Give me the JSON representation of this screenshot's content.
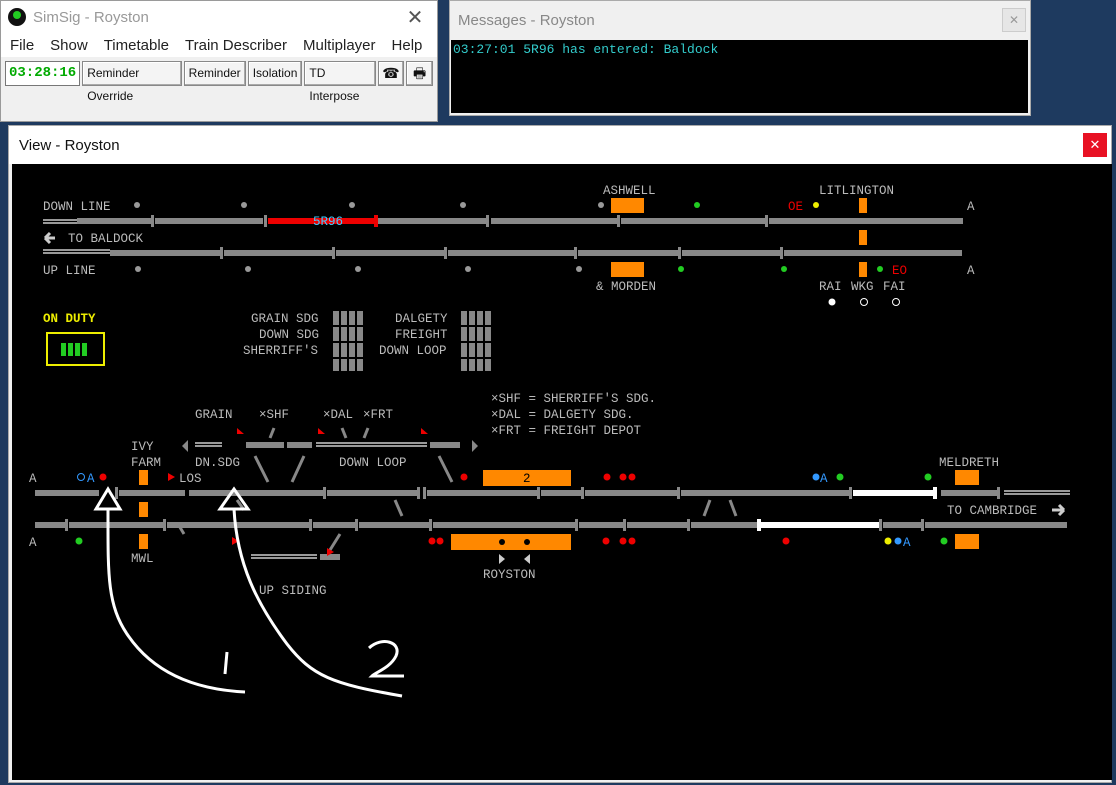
{
  "main_window": {
    "title": "SimSig - Royston",
    "close": "✕",
    "menu": [
      "File",
      "Show",
      "Timetable",
      "Train Describer",
      "Multiplayer",
      "Help"
    ],
    "clock": "03:28:16",
    "buttons": [
      "Reminder Override",
      "Reminder",
      "Isolation",
      "TD Interpose"
    ],
    "phone_icon": "☎",
    "printer_icon": "🖶"
  },
  "messages_window": {
    "title": "Messages - Royston",
    "close": "✕",
    "lines": [
      "03:27:01 5R96 has entered: Baldock"
    ]
  },
  "view_window": {
    "title": "View - Royston",
    "close": "✕"
  },
  "diagram": {
    "top": {
      "down_line": "DOWN LINE",
      "to_baldock": "TO BALDOCK",
      "up_line": "UP LINE",
      "ashwell": "ASHWELL",
      "and_morden": "& MORDEN",
      "litlington": "LITLINGTON",
      "train": "5R96",
      "oe": "OE",
      "eo": "EO",
      "rai": "RAI",
      "wkg": "WKG",
      "fai": "FAI",
      "a1": "A",
      "a2": "A"
    },
    "on_duty": "ON DUTY",
    "indicators": {
      "grain_sdg": "GRAIN SDG",
      "down_sdg": "DOWN SDG",
      "sherriffs": "SHERRIFF'S",
      "dalgety": "DALGETY",
      "freight": "FREIGHT",
      "down_loop": "DOWN LOOP"
    },
    "legend": [
      "×SHF = SHERRIFF'S SDG.",
      "×DAL = DALGETY SDG.",
      "×FRT = FREIGHT DEPOT"
    ],
    "lower": {
      "grain": "GRAIN",
      "shf": "×SHF",
      "dal": "×DAL",
      "frt": "×FRT",
      "ivy": "IVY",
      "farm": "FARM",
      "dn_sdg": "DN.SDG",
      "los": "LOS",
      "down_loop": "DOWN LOOP",
      "td2": "2",
      "meldreth": "MELDRETH",
      "to_cambridge": "TO CAMBRIDGE",
      "mwl": "MWL",
      "up_siding": "UP SIDING",
      "royston": "ROYSTON",
      "a_left_top": "A",
      "a_left_bot": "A",
      "oa": "A",
      "ma": "A",
      "ba": "A"
    },
    "annotations": [
      "1",
      "2"
    ]
  }
}
